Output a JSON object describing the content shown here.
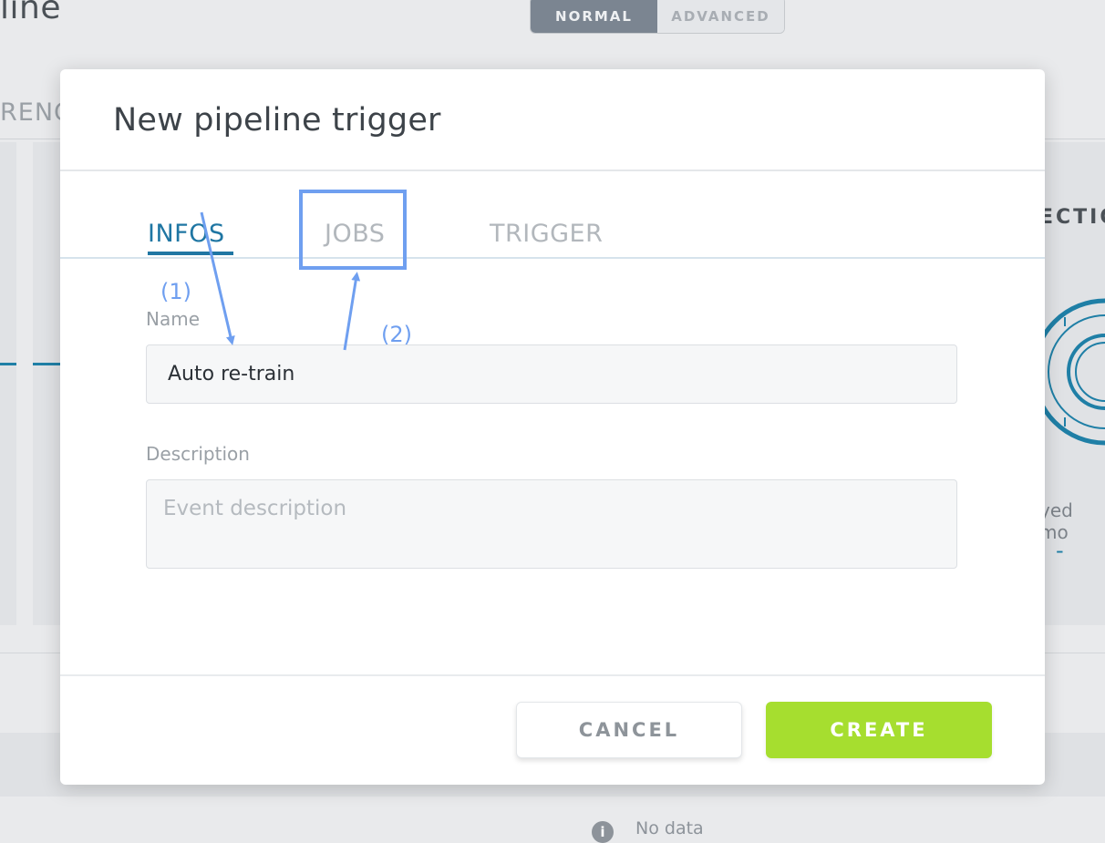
{
  "background": {
    "page_title_fragment": "line",
    "mode_toggle": {
      "normal_label": "NORMAL",
      "advanced_label": "ADVANCED",
      "selected": "NORMAL"
    },
    "tab_fragment": "RENC",
    "section_fragment": "ECTIO",
    "deployed_fragment": "yed mo",
    "metric_value": "-",
    "no_data_text": "No data",
    "info_icon_glyph": "i"
  },
  "modal": {
    "title": "New pipeline trigger",
    "tabs": [
      {
        "label": "INFOS",
        "active": true
      },
      {
        "label": "JOBS",
        "active": false
      },
      {
        "label": "TRIGGER",
        "active": false
      }
    ],
    "fields": {
      "name": {
        "label": "Name",
        "value": "Auto re-train"
      },
      "description": {
        "label": "Description",
        "value": "",
        "placeholder": "Event description"
      }
    },
    "buttons": {
      "cancel": "CANCEL",
      "create": "CREATE"
    }
  },
  "annotations": {
    "label_1": "(1)",
    "label_2": "(2)",
    "color": "#6f9ff0"
  },
  "colors": {
    "accent": "#1f76a3",
    "create_button": "#a6de2f",
    "annotation": "#6f9ff0"
  }
}
